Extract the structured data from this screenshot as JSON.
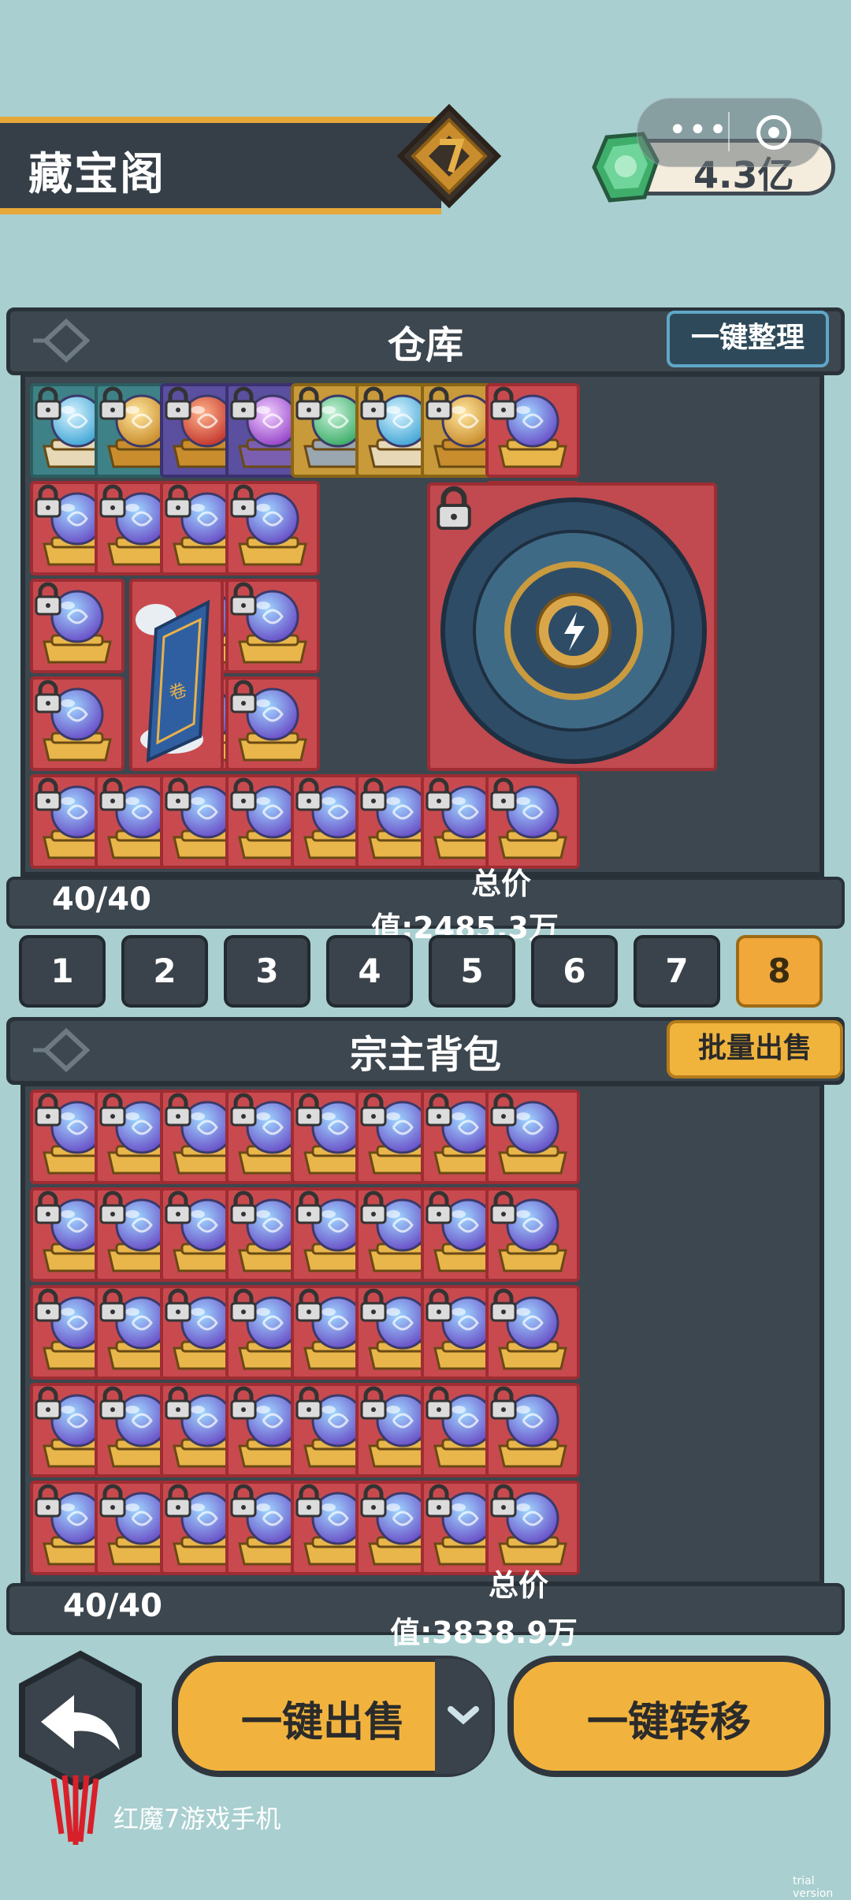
{
  "header": {
    "title": "藏宝阁",
    "currency_value": "4.3亿",
    "capsule_dots": "•••"
  },
  "warehouse": {
    "title": "仓库",
    "tidy_button": "一键整理",
    "count": "40/40",
    "total_label": "总价",
    "total_value": "值:2485.3万"
  },
  "pages": [
    "1",
    "2",
    "3",
    "4",
    "5",
    "6",
    "7",
    "8"
  ],
  "active_page": "8",
  "backpack": {
    "title": "宗主背包",
    "batch_sell_button": "批量出售",
    "count": "40/40",
    "total_label": "总价",
    "total_value": "值:3838.9万"
  },
  "actions": {
    "sell_all": "一键出售",
    "transfer_all": "一键转移"
  },
  "watermark": {
    "brand": "红魔7游戏手机",
    "trial": "trial version"
  },
  "colors": {
    "background": "#a9cfd0",
    "panel": "#3d474f",
    "accent": "#f0b43d",
    "cell_red": "#c84a4f",
    "cell_teal": "#3e8287",
    "cell_gold": "#c89a3a",
    "cell_purple": "#5b4f9f"
  },
  "icons": {
    "item": "orb-on-pedestal-icon",
    "lock": "lock-icon",
    "back": "back-arrow-icon",
    "currency": "green-gem-icon",
    "special_scroll": "scroll-icon",
    "special_disc": "compass-disc-icon"
  }
}
